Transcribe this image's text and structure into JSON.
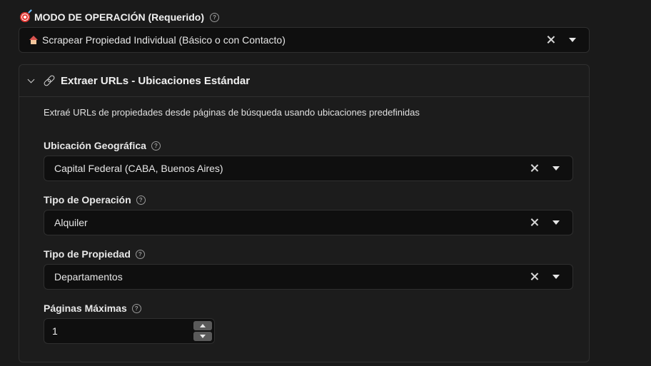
{
  "mode": {
    "label": "MODO DE OPERACIÓN (Requerido)",
    "icon": "target-icon",
    "help_icon": "?",
    "selected": "Scrapear Propiedad Individual (Básico o con Contacto)",
    "selected_icon": "house-icon"
  },
  "panel": {
    "title": "Extraer URLs - Ubicaciones Estándar",
    "icon": "link-icon",
    "expanded": true,
    "description": "Extraé URLs de propiedades desde páginas de búsqueda usando ubicaciones predefinidas"
  },
  "fields": {
    "location": {
      "label": "Ubicación Geográfica",
      "help_icon": "?",
      "value": "Capital Federal (CABA, Buenos Aires)"
    },
    "operation": {
      "label": "Tipo de Operación",
      "help_icon": "?",
      "value": "Alquiler"
    },
    "property": {
      "label": "Tipo de Propiedad",
      "help_icon": "?",
      "value": "Departamentos"
    },
    "max_pages": {
      "label": "Páginas Máximas",
      "help_icon": "?",
      "value": "1"
    }
  },
  "colors": {
    "background": "#1a1a1a",
    "input_background": "#0f0f0f",
    "border": "#2f2f2f",
    "text": "#e6e6e6"
  }
}
